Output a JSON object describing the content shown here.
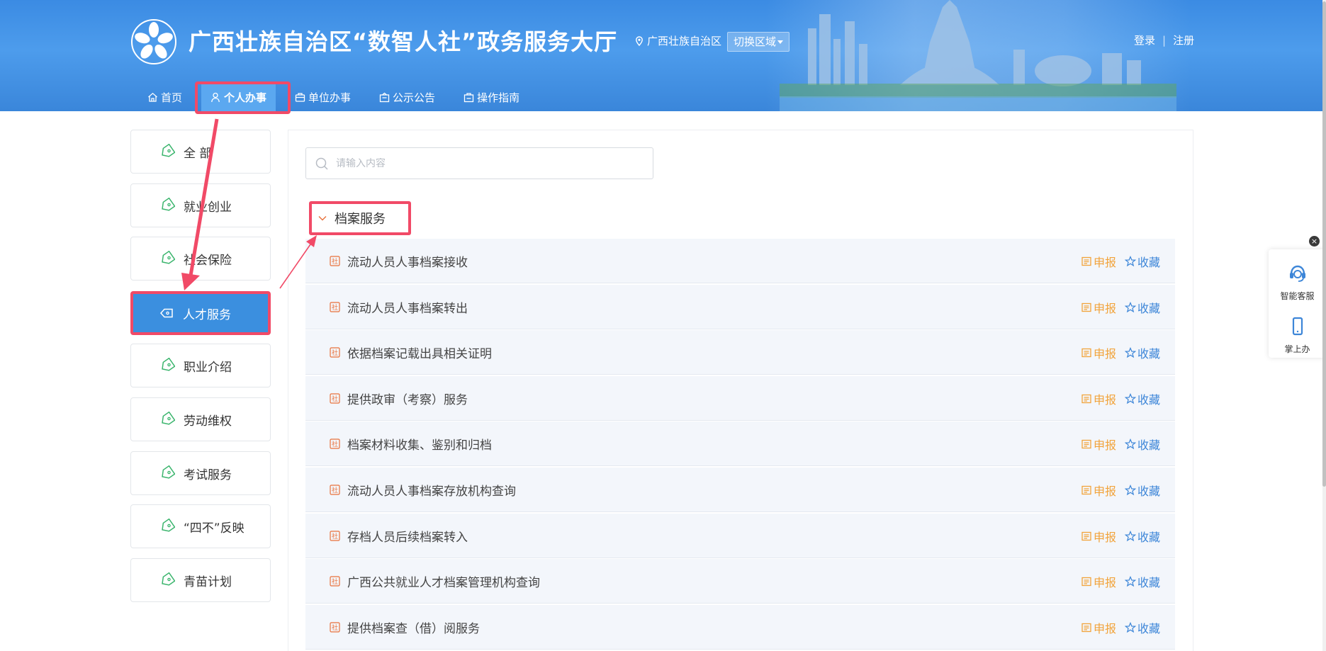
{
  "header": {
    "site_title": "广西壮族自治区“数智人社”政务服务大厅",
    "region_name": "广西壮族自治区",
    "switch_region_label": "切换区域",
    "login_label": "登录",
    "register_label": "注册",
    "nav": [
      {
        "label": "首页",
        "icon": "home-icon",
        "active": false
      },
      {
        "label": "个人办事",
        "icon": "person-icon",
        "active": true
      },
      {
        "label": "单位办事",
        "icon": "briefcase-icon",
        "active": false
      },
      {
        "label": "公示公告",
        "icon": "bulletin-icon",
        "active": false
      },
      {
        "label": "操作指南",
        "icon": "guide-icon",
        "active": false
      }
    ]
  },
  "sidebar": {
    "items": [
      {
        "label": "全 部",
        "active": false
      },
      {
        "label": "就业创业",
        "active": false
      },
      {
        "label": "社会保险",
        "active": false
      },
      {
        "label": "人才服务",
        "active": true
      },
      {
        "label": "职业介绍",
        "active": false
      },
      {
        "label": "劳动维权",
        "active": false
      },
      {
        "label": "考试服务",
        "active": false
      },
      {
        "label": "“四不”反映",
        "active": false
      },
      {
        "label": "青苗计划",
        "active": false
      }
    ]
  },
  "search": {
    "placeholder": "请输入内容",
    "value": ""
  },
  "section": {
    "title": "档案服务",
    "expanded": true
  },
  "services": [
    {
      "name": "流动人员人事档案接收"
    },
    {
      "name": "流动人员人事档案转出"
    },
    {
      "name": "依据档案记载出具相关证明"
    },
    {
      "name": "提供政审（考察）服务"
    },
    {
      "name": "档案材料收集、鉴别和归档"
    },
    {
      "name": "流动人员人事档案存放机构查询"
    },
    {
      "name": "存档人员后续档案转入"
    },
    {
      "name": "广西公共就业人才档案管理机构查询"
    },
    {
      "name": "提供档案查（借）阅服务"
    }
  ],
  "service_actions": {
    "apply_label": "申报",
    "favorite_label": "收藏"
  },
  "float_widget": {
    "close_label": "×",
    "items": [
      {
        "label": "智能客服",
        "icon": "headset-icon"
      },
      {
        "label": "掌上办",
        "icon": "phone-icon"
      }
    ]
  },
  "colors": {
    "header_blue": "#4d9cec",
    "active_blue": "#3b8fdf",
    "highlight_red": "#f14a67",
    "apply_orange": "#f2a33a",
    "favorite_blue": "#3d86d8",
    "tag_green": "#3bb56d",
    "row_bg": "#f3f6fb"
  }
}
